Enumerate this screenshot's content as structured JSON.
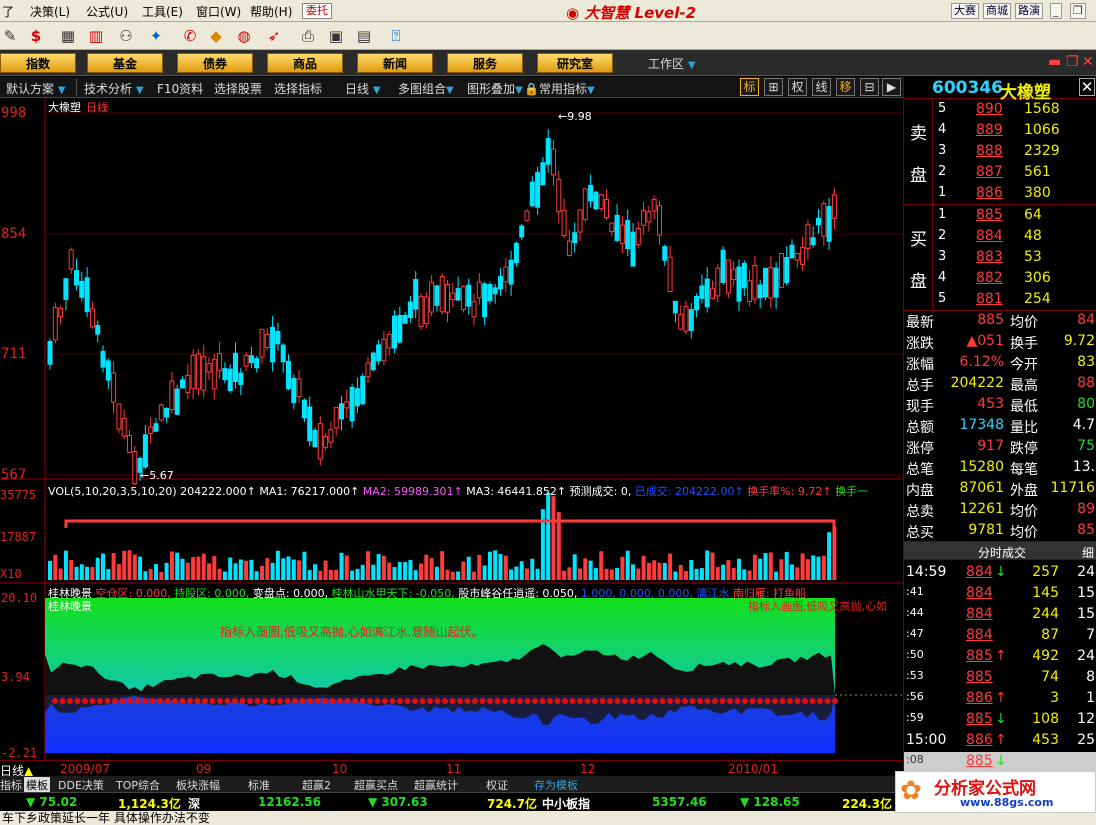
{
  "menu": [
    "了",
    "决策(L)",
    "公式(U)",
    "工具(E)",
    "窗口(W)",
    "帮助(H)"
  ],
  "weituo": "委托",
  "app_title": "大智慧 Level-2",
  "top_right_btns": [
    "大赛",
    "商城",
    "路演"
  ],
  "categories": [
    "指数",
    "基金",
    "债券",
    "商品",
    "新闻",
    "服务",
    "研究室"
  ],
  "workspace": "工作区",
  "funcbar": [
    "默认方案",
    "技术分析",
    "F10资料",
    "选择股票",
    "选择指标",
    "日线",
    "多图组合",
    "图形叠加",
    "常用指标"
  ],
  "funcbtns": [
    "标",
    "⊞",
    "权",
    "线",
    "移",
    "⊟",
    "▶"
  ],
  "chart": {
    "stock_name": "大橡塑",
    "period": "日线",
    "price_labels": [
      "998",
      "854",
      "711",
      "567"
    ],
    "high_label": "9.98",
    "low_label": "5.67",
    "vol_info": [
      {
        "t": "VOL(5,10,20,3,5,10,20)",
        "c": "#ffffff"
      },
      {
        "t": "204222.000↑",
        "c": "#ffffff"
      },
      {
        "t": "MA1: 76217.000↑",
        "c": "#ffffff"
      },
      {
        "t": "MA2: 59989.301↑",
        "c": "#ff55ff"
      },
      {
        "t": "MA3: 46441.852↑",
        "c": "#ffffff"
      },
      {
        "t": "预测成交: 0,",
        "c": "#ffffff"
      },
      {
        "t": "已成交: 204222.00↑",
        "c": "#2050ff"
      },
      {
        "t": "换手率%: 9.72↑",
        "c": "#ff3a3a"
      },
      {
        "t": "换手一",
        "c": "#22dd22"
      }
    ],
    "vol_labels": [
      "35775",
      "17887",
      "X10"
    ],
    "ind_info": [
      {
        "t": "桂林晚景",
        "c": "#ffffff"
      },
      {
        "t": "空仓区: 0.000,",
        "c": "#ff3a3a"
      },
      {
        "t": "持股区: 0.000,",
        "c": "#22dd22"
      },
      {
        "t": "变盘点: 0.000,",
        "c": "#ffffff"
      },
      {
        "t": "桂林山水甲天下: -0.050,",
        "c": "#22dd22"
      },
      {
        "t": "股市峰谷任逍遥: 0.050,",
        "c": "#ffffff"
      },
      {
        "t": "1.000,",
        "c": "#2050ff"
      },
      {
        "t": "0.000,",
        "c": "#2050ff"
      },
      {
        "t": "0.000,",
        "c": "#2050ff"
      },
      {
        "t": "漓江水",
        "c": "#2050ff"
      },
      {
        "t": "南归雁: 打鱼船",
        "c": "#ff3a3a"
      }
    ],
    "ind_name": "桂林晚景",
    "ind_text": "指标入画图,低吸又高抛,心如漓江水,意随山起伏。",
    "ind_text_right": "指标入画图,低吸又高抛,心如",
    "ind_labels": [
      "20.10",
      "3.94",
      "-2.21"
    ],
    "dates": [
      "2009/07",
      "09",
      "10",
      "11",
      "12",
      "2010/01"
    ],
    "period_tab": "日线"
  },
  "tabs": [
    "指标",
    "模板",
    "DDE决策",
    "TOP综合",
    "板块涨幅",
    "标准",
    "超赢2",
    "超赢买点",
    "超赢统计",
    "权证",
    "存为模板"
  ],
  "status": [
    {
      "t": "▼ 75.02",
      "c": "#22dd22"
    },
    {
      "t": "1,124.3亿",
      "c": "#ffff00"
    },
    {
      "t": "深",
      "c": "#ffffff"
    },
    {
      "t": "12162.56",
      "c": "#22dd22"
    },
    {
      "t": "▼ 307.63",
      "c": "#22dd22"
    },
    {
      "t": "724.7亿",
      "c": "#ffff00"
    },
    {
      "t": "中小板指",
      "c": "#ffffff"
    },
    {
      "t": "5357.46",
      "c": "#22dd22"
    },
    {
      "t": "▼ 128.65",
      "c": "#22dd22"
    },
    {
      "t": "224.3亿",
      "c": "#ffff00"
    }
  ],
  "ticker": "车下乡政策延长一年 具体操作办法不变",
  "quote": {
    "code": "600346",
    "name": "大橡塑",
    "sell": [
      [
        "5",
        "890",
        "1568"
      ],
      [
        "4",
        "889",
        "1066"
      ],
      [
        "3",
        "888",
        "2329"
      ],
      [
        "2",
        "887",
        "561"
      ],
      [
        "1",
        "886",
        "380"
      ]
    ],
    "buy": [
      [
        "1",
        "885",
        "64"
      ],
      [
        "2",
        "884",
        "48"
      ],
      [
        "3",
        "883",
        "53"
      ],
      [
        "4",
        "882",
        "306"
      ],
      [
        "5",
        "881",
        "254"
      ]
    ],
    "sell_label": [
      "卖",
      "盘"
    ],
    "buy_label": [
      "买",
      "盘"
    ],
    "stats": [
      [
        "最新",
        "885",
        "均价",
        "84"
      ],
      [
        "涨跌",
        "▲051",
        "换手",
        "9.72"
      ],
      [
        "涨幅",
        "6.12%",
        "今开",
        "83"
      ],
      [
        "总手",
        "204222",
        "最高",
        "88"
      ],
      [
        "现手",
        "453",
        "最低",
        "80"
      ],
      [
        "总额",
        "17348",
        "量比",
        "4.7"
      ],
      [
        "涨停",
        "917",
        "跌停",
        "75"
      ],
      [
        "总笔",
        "15280",
        "每笔",
        "13."
      ],
      [
        "内盘",
        "87061",
        "外盘",
        "11716"
      ],
      [
        "总卖",
        "12261",
        "均价",
        "89"
      ],
      [
        "总买",
        "9781",
        "均价",
        "85"
      ]
    ],
    "trade_header": "分时成交",
    "trade_tab": "细",
    "trades": [
      [
        "14:59",
        "884",
        "↓",
        "257",
        "24"
      ],
      [
        ":41",
        "884",
        "",
        "145",
        "15"
      ],
      [
        ":44",
        "884",
        "",
        "244",
        "15"
      ],
      [
        ":47",
        "884",
        "",
        "87",
        "7"
      ],
      [
        ":50",
        "885",
        "↑",
        "492",
        "24"
      ],
      [
        ":53",
        "885",
        "",
        "74",
        "8"
      ],
      [
        ":56",
        "886",
        "↑",
        "3",
        "1"
      ],
      [
        ":59",
        "885",
        "↓",
        "108",
        "12"
      ],
      [
        "15:00",
        "886",
        "↑",
        "453",
        "25"
      ],
      [
        ":08",
        "885",
        "↓",
        "",
        ""
      ]
    ]
  },
  "logo": {
    "main": "分析家公式网",
    "url": "www.88gs.com"
  },
  "colors": {
    "up": "#ff3a3a",
    "down": "#00e5ff",
    "gold": "#f0b020"
  }
}
